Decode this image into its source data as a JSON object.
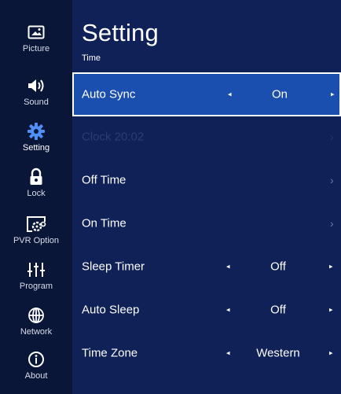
{
  "sidebar": {
    "items": [
      {
        "label": "Picture",
        "icon": "picture-icon"
      },
      {
        "label": "Sound",
        "icon": "speaker-icon"
      },
      {
        "label": "Setting",
        "icon": "gear-icon",
        "active": true
      },
      {
        "label": "Lock",
        "icon": "lock-icon"
      },
      {
        "label": "PVR Option",
        "icon": "pvr-gear-icon"
      },
      {
        "label": "Program",
        "icon": "sliders-icon"
      },
      {
        "label": "Network",
        "icon": "globe-icon"
      },
      {
        "label": "About",
        "icon": "info-icon"
      }
    ]
  },
  "header": {
    "title": "Setting",
    "subtitle": "Time"
  },
  "rows": [
    {
      "label": "Auto Sync",
      "value": "On",
      "selected": true
    },
    {
      "label": "Clock 20:02",
      "disabled": true
    },
    {
      "label": "Off Time"
    },
    {
      "label": "On Time"
    },
    {
      "label": "Sleep Timer",
      "value": "Off"
    },
    {
      "label": "Auto Sleep",
      "value": "Off"
    },
    {
      "label": "Time Zone",
      "value": "Western"
    }
  ],
  "glyphs": {
    "left": "◂",
    "right": "▸",
    "chevron": "›"
  },
  "colors": {
    "sidebar_bg": "#0a1638",
    "main_bg": "#0f2157",
    "selected_bg": "#1a4fb0",
    "accent_gear": "#4f8ef7",
    "disabled_text": "#2b3d73"
  }
}
